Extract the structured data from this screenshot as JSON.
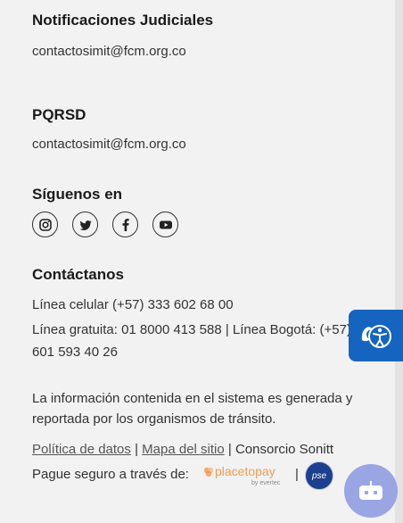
{
  "notificaciones": {
    "heading": "Notificaciones Judiciales",
    "email": "contactosimit@fcm.org.co"
  },
  "pqrsd": {
    "heading": "PQRSD",
    "email": "contactosimit@fcm.org.co"
  },
  "social": {
    "heading": "Síguenos en",
    "icons": [
      "instagram-icon",
      "twitter-icon",
      "facebook-icon",
      "youtube-icon"
    ]
  },
  "contacto": {
    "heading": "Contáctanos",
    "celular": "Línea celular (+57) 333 602 68 00",
    "gratuita_line1": "Línea gratuita: 01 8000 413 588 | Línea Bogotá: (+57)",
    "gratuita_line2": "601 593 40 26"
  },
  "info": {
    "line1": "La información contenida en el sistema es generada y",
    "line2": "reportada por los organismos de tránsito."
  },
  "footer": {
    "politica": "Política de datos",
    "mapa": "Mapa del sitio",
    "consorcio": "Consorcio Sonitt",
    "pague": "Pague seguro a través de:",
    "separator": "|"
  },
  "logos": {
    "placetopay_text": "placetopay",
    "evertec_text": "by evertec",
    "pse_text": "pse"
  },
  "colors": {
    "background": "#f2f2f2",
    "accessibility_button": "#1565c0",
    "chatbot_button": "#9aa6e3",
    "placetopay_orange": "#f39c53",
    "placetopay_gray": "#8a8a8a",
    "pse_blue": "#1d3f8f"
  }
}
